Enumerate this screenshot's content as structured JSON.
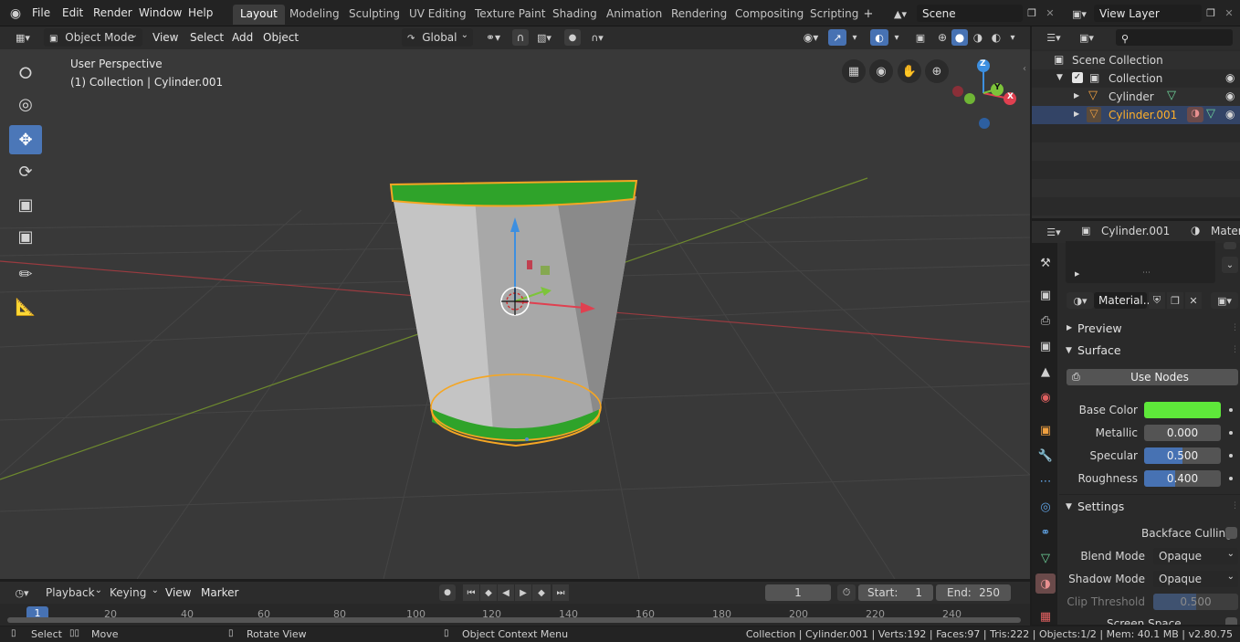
{
  "topbar": {
    "menus": [
      "File",
      "Edit",
      "Render",
      "Window",
      "Help"
    ],
    "workspaces": [
      "Layout",
      "Modeling",
      "Sculpting",
      "UV Editing",
      "Texture Paint",
      "Shading",
      "Animation",
      "Rendering",
      "Compositing",
      "Scripting"
    ],
    "active_workspace": "Layout",
    "scene": "Scene",
    "view_layer": "View Layer"
  },
  "viewport_header": {
    "mode": "Object Mode",
    "menus": [
      "View",
      "Select",
      "Add",
      "Object"
    ],
    "orientation": "Global"
  },
  "viewport": {
    "perspective": "User Perspective",
    "collection_info": "(1) Collection | Cylinder.001",
    "gizmo_axes": [
      "Z",
      "Y",
      "X"
    ]
  },
  "outliner": {
    "scene_collection": "Scene Collection",
    "collection": "Collection",
    "objects": [
      {
        "name": "Cylinder",
        "active": false
      },
      {
        "name": "Cylinder.001",
        "active": true
      }
    ]
  },
  "properties": {
    "object_name": "Cylinder.001",
    "tab_partial": "Materi",
    "material_slot": "Material..",
    "sections": {
      "preview": "Preview",
      "surface": "Surface",
      "settings": "Settings"
    },
    "use_nodes": "Use Nodes",
    "base_color_label": "Base Color",
    "base_color": "#5ee83a",
    "metallic": {
      "label": "Metallic",
      "value": "0.000",
      "fraction": 0.0
    },
    "specular": {
      "label": "Specular",
      "value": "0.500",
      "fraction": 0.5
    },
    "roughness": {
      "label": "Roughness",
      "value": "0.400",
      "fraction": 0.4
    },
    "backface_culling": "Backface Culling",
    "blend_mode": {
      "label": "Blend Mode",
      "value": "Opaque"
    },
    "shadow_mode": {
      "label": "Shadow Mode",
      "value": "Opaque"
    },
    "clip_threshold": {
      "label": "Clip Threshold",
      "value": "0.500",
      "fraction": 0.5
    },
    "cut_off_row": "Screen Space Refraction"
  },
  "timeline": {
    "menus": [
      "Playback",
      "Keying",
      "View",
      "Marker"
    ],
    "current_frame": "1",
    "start_label": "Start:",
    "start": "1",
    "end_label": "End:",
    "end": "250",
    "ruler": [
      "1",
      "20",
      "40",
      "60",
      "80",
      "100",
      "120",
      "140",
      "160",
      "180",
      "200",
      "220",
      "240"
    ]
  },
  "statusbar": {
    "select": "Select",
    "move": "Move",
    "rotate": "Rotate View",
    "context": "Object Context Menu",
    "stats": "Collection | Cylinder.001 | Verts:192 | Faces:97 | Tris:222 | Objects:1/2 | Mem: 40.1 MB | v2.80.75"
  },
  "colors": {
    "accent": "#4772b3",
    "selection_outline": "#f5a623",
    "active_object_text": "#ffaf29",
    "cup_green": "#2fa32a"
  }
}
